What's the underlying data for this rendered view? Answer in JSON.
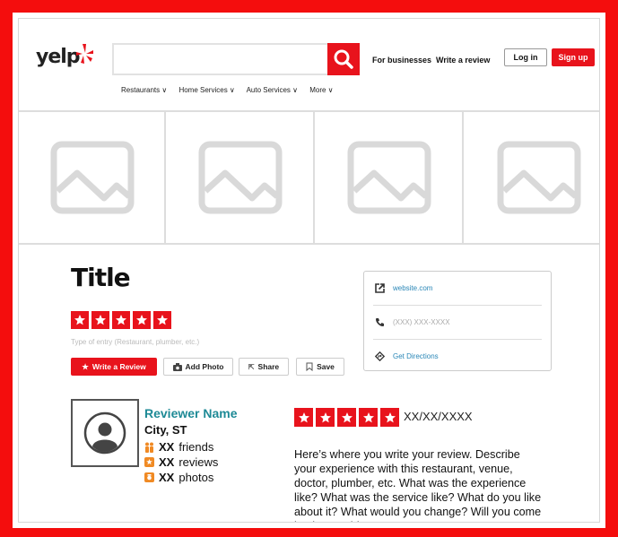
{
  "header": {
    "logo_text": "yelp",
    "search_placeholder": "",
    "for_businesses": "For businesses",
    "write_review": "Write a review",
    "login": "Log in",
    "signup": "Sign up"
  },
  "categories": [
    "Restaurants ∨",
    "Home Services ∨",
    "Auto Services ∨",
    "More ∨"
  ],
  "business": {
    "title": "Title",
    "rating": 5,
    "type_hint": "Type of entry (Restaurant, plumber, etc.)",
    "actions": {
      "write_review": "Write a Review",
      "add_photo": "Add Photo",
      "share": "Share",
      "save": "Save"
    },
    "info": {
      "website": "website.com",
      "phone": "(XXX) XXX-XXXX",
      "directions": "Get Directions"
    }
  },
  "review": {
    "reviewer_name": "Reviewer Name",
    "location": "City, ST",
    "friends_count": "XX",
    "friends_label": "friends",
    "reviews_count": "XX",
    "reviews_label": "reviews",
    "photos_count": "XX",
    "photos_label": "photos",
    "rating": 5,
    "date": "XX/XX/XXXX",
    "text": "Here’s where you write your review. Describe your experience with this restaurant, venue, doctor, plumber, etc. What was the experience like? What was the service like? What do you like about it? What would you change? Will you come back? Would you"
  },
  "colors": {
    "brand_red": "#e8131c",
    "link_teal": "#1e8a96",
    "link_blue": "#2a87b7"
  }
}
